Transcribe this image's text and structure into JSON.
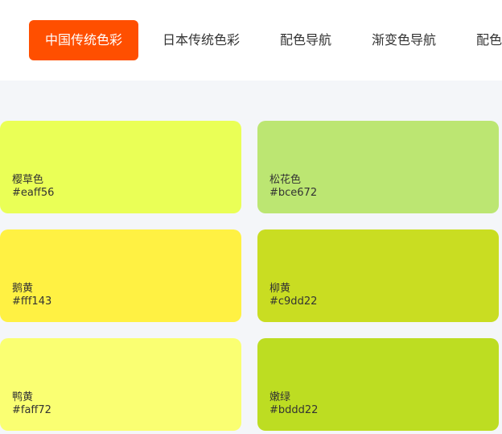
{
  "nav": {
    "items": [
      {
        "label": "中国传统色彩",
        "active": true
      },
      {
        "label": "日本传统色彩",
        "active": false
      },
      {
        "label": "配色导航",
        "active": false
      },
      {
        "label": "渐变色导航",
        "active": false
      },
      {
        "label": "配色",
        "active": false
      }
    ],
    "accent_color": "#ff4f00"
  },
  "colors": [
    {
      "name": "樱草色",
      "hex": "#eaff56"
    },
    {
      "name": "松花色",
      "hex": "#bce672"
    },
    {
      "name": "鹅黄",
      "hex": "#fff143"
    },
    {
      "name": "柳黄",
      "hex": "#c9dd22"
    },
    {
      "name": "鸭黄",
      "hex": "#faff72"
    },
    {
      "name": "嫩绿",
      "hex": "#bddd22"
    }
  ]
}
